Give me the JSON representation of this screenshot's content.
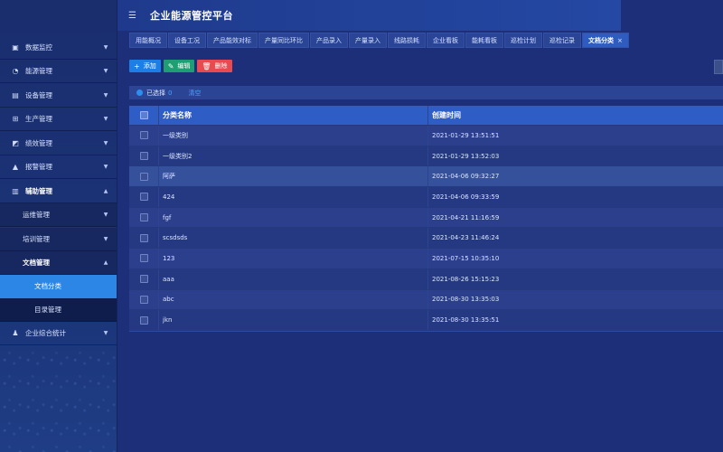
{
  "app": {
    "title": "企业能源管控平台"
  },
  "sidebar": {
    "items": [
      {
        "label": "数据监控",
        "icon": "monitor-icon",
        "glyph": "▣"
      },
      {
        "label": "能源管理",
        "icon": "energy-icon",
        "glyph": "◔"
      },
      {
        "label": "设备管理",
        "icon": "device-icon",
        "glyph": "▤"
      },
      {
        "label": "生产管理",
        "icon": "grid-icon",
        "glyph": "⊞"
      },
      {
        "label": "绩效管理",
        "icon": "chart-icon",
        "glyph": "◩"
      },
      {
        "label": "报警管理",
        "icon": "alarm-icon",
        "glyph": "▲"
      },
      {
        "label": "辅助管理",
        "icon": "tools-icon",
        "glyph": "▥"
      },
      {
        "label": "运维管理"
      },
      {
        "label": "培训管理"
      },
      {
        "label": "文档管理"
      },
      {
        "label": "文档分类"
      },
      {
        "label": "目录管理"
      },
      {
        "label": "企业综合统计",
        "icon": "people-icon",
        "glyph": "♟"
      }
    ]
  },
  "tabs": [
    {
      "label": "用能概况"
    },
    {
      "label": "设备工况"
    },
    {
      "label": "产品能效对标"
    },
    {
      "label": "产量同比环比"
    },
    {
      "label": "产品录入"
    },
    {
      "label": "产量录入"
    },
    {
      "label": "线路损耗"
    },
    {
      "label": "企业看板"
    },
    {
      "label": "能耗看板"
    },
    {
      "label": "巡检计划"
    },
    {
      "label": "巡检记录"
    },
    {
      "label": "文档分类",
      "close": "×"
    }
  ],
  "toolbar": {
    "add_label": "添加",
    "edit_label": "编辑",
    "delete_label": "删除"
  },
  "selection": {
    "label": "已选择",
    "count": "0",
    "clear": "清空"
  },
  "table": {
    "headers": {
      "name": "分类名称",
      "time": "创建时间"
    },
    "rows": [
      {
        "name": "一级类别",
        "time": "2021-01-29 13:51:51"
      },
      {
        "name": "一级类别2",
        "time": "2021-01-29 13:52:03"
      },
      {
        "name": "阿萨",
        "time": "2021-04-06 09:32:27"
      },
      {
        "name": "424",
        "time": "2021-04-06 09:33:59"
      },
      {
        "name": "fgf",
        "time": "2021-04-21 11:16:59"
      },
      {
        "name": "scsdsds",
        "time": "2021-04-23 11:46:24"
      },
      {
        "name": "123",
        "time": "2021-07-15 10:35:10"
      },
      {
        "name": "aaa",
        "time": "2021-08-26 15:15:23"
      },
      {
        "name": "abc",
        "time": "2021-08-30 13:35:03"
      },
      {
        "name": "jkn",
        "time": "2021-08-30 13:35:51"
      }
    ]
  },
  "colors": {
    "accent": "#2b86e6",
    "add": "#1d7ee6",
    "edit": "#1e9f73",
    "delete": "#e84a50",
    "background": "#1d2f78"
  }
}
